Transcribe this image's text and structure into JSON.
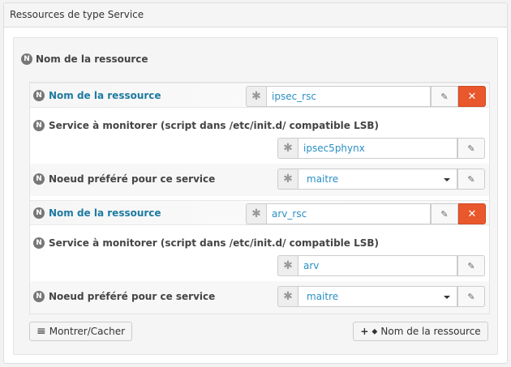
{
  "panel": {
    "title": "Ressources de type Service"
  },
  "section": {
    "title": "Nom de la ressource",
    "badge": "N"
  },
  "resources": [
    {
      "name_label": "Nom de la ressource",
      "name_value": "ipsec_rsc",
      "service_label": "Service à monitorer (script dans /etc/init.d/ compatible LSB)",
      "service_value": "ipsec5phynx",
      "node_label": "Noeud préféré pour ce service",
      "node_value": "maitre"
    },
    {
      "name_label": "Nom de la ressource",
      "name_value": "arv_rsc",
      "service_label": "Service à monitorer (script dans /etc/init.d/ compatible LSB)",
      "service_value": "arv",
      "node_label": "Noeud préféré pour ce service",
      "node_value": "maitre"
    }
  ],
  "buttons": {
    "toggle": "Montrer/Cacher",
    "add": "Nom de la ressource"
  },
  "icons": {
    "asterisk": "✱",
    "edit": "✎",
    "delete": "✕",
    "list": "≡",
    "plus": "+",
    "tag": "⬥"
  },
  "colors": {
    "accent": "#2a8fc4",
    "danger": "#e9572c",
    "label_teal": "#1e7aa1"
  }
}
